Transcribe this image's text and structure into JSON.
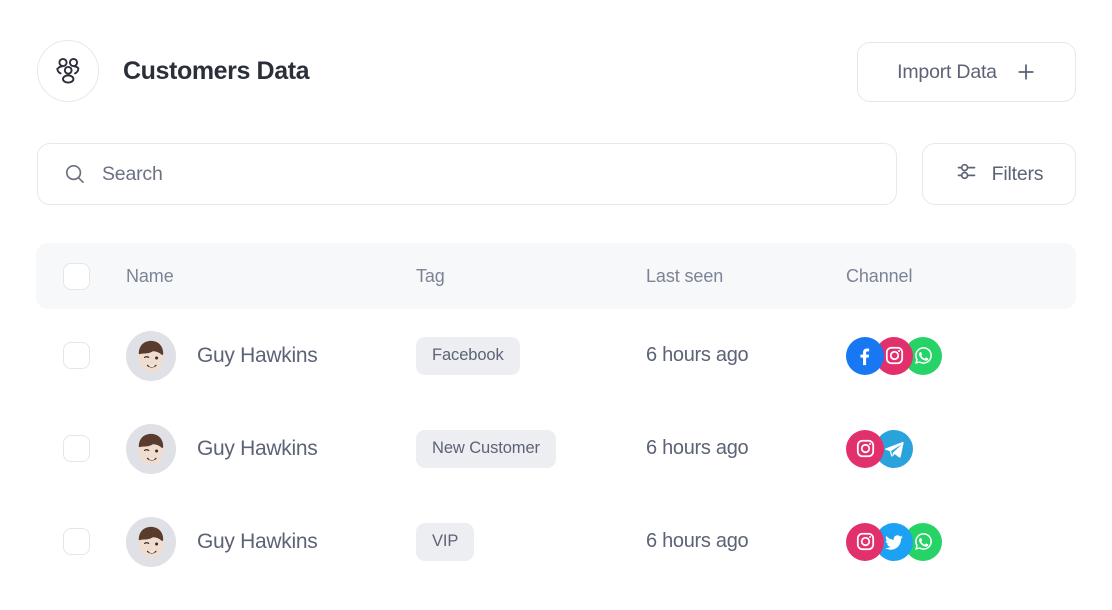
{
  "header": {
    "logo_icon": "users-group-icon",
    "title": "Customers Data",
    "import_button": {
      "label": "Import Data",
      "icon": "plus-icon"
    }
  },
  "search": {
    "icon": "search-icon",
    "placeholder": "Search",
    "value": ""
  },
  "filters_button": {
    "label": "Filters",
    "icon": "filter-sliders-icon"
  },
  "table": {
    "columns": [
      {
        "key": "select",
        "label": ""
      },
      {
        "key": "name",
        "label": "Name"
      },
      {
        "key": "tag",
        "label": "Tag"
      },
      {
        "key": "last_seen",
        "label": "Last seen"
      },
      {
        "key": "channel",
        "label": "Channel"
      }
    ],
    "select_all_checked": false,
    "rows": [
      {
        "selected": false,
        "avatar": "memoji-avatar",
        "name": "Guy Hawkins",
        "tag": "Facebook",
        "last_seen": "6 hours ago",
        "channels": [
          "facebook",
          "instagram",
          "whatsapp"
        ]
      },
      {
        "selected": false,
        "avatar": "memoji-avatar",
        "name": "Guy Hawkins",
        "tag": "New Customer",
        "last_seen": "6 hours ago",
        "channels": [
          "instagram",
          "telegram"
        ]
      },
      {
        "selected": false,
        "avatar": "memoji-avatar",
        "name": "Guy Hawkins",
        "tag": "VIP",
        "last_seen": "6 hours ago",
        "channels": [
          "instagram",
          "twitter",
          "whatsapp"
        ]
      }
    ]
  },
  "colors": {
    "title": "#2b2f3a",
    "muted_text": "#5d6376",
    "header_text": "#7d8396",
    "border": "#e7e8ec",
    "header_band": "#f7f8fa",
    "tag_bg": "#eceef1",
    "facebook": "#1877F2",
    "instagram": "#E1306C",
    "whatsapp": "#25D366",
    "telegram": "#2AA3DC",
    "twitter": "#1DA1F2"
  }
}
